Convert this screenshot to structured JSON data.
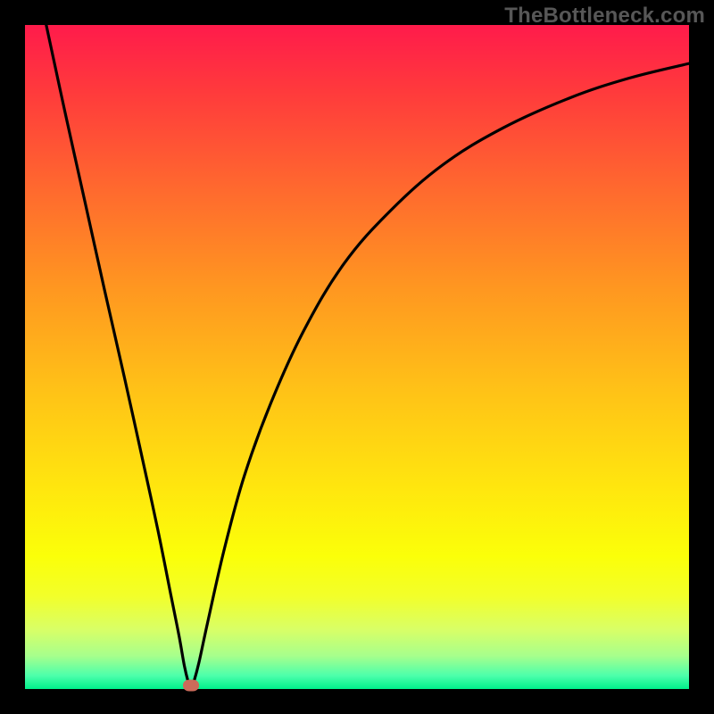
{
  "watermark": "TheBottleneck.com",
  "chart_data": {
    "type": "line",
    "title": "",
    "xlabel": "",
    "ylabel": "",
    "xlim": [
      0,
      1
    ],
    "ylim": [
      0,
      1
    ],
    "grid": false,
    "series": [
      {
        "name": "curve",
        "color": "#000000",
        "points": [
          {
            "x": 0.032,
            "y": 1.0
          },
          {
            "x": 0.06,
            "y": 0.87
          },
          {
            "x": 0.09,
            "y": 0.735
          },
          {
            "x": 0.12,
            "y": 0.6
          },
          {
            "x": 0.15,
            "y": 0.468
          },
          {
            "x": 0.175,
            "y": 0.355
          },
          {
            "x": 0.2,
            "y": 0.24
          },
          {
            "x": 0.22,
            "y": 0.14
          },
          {
            "x": 0.232,
            "y": 0.08
          },
          {
            "x": 0.24,
            "y": 0.035
          },
          {
            "x": 0.246,
            "y": 0.01
          },
          {
            "x": 0.25,
            "y": 0.0
          },
          {
            "x": 0.254,
            "y": 0.01
          },
          {
            "x": 0.262,
            "y": 0.04
          },
          {
            "x": 0.275,
            "y": 0.1
          },
          {
            "x": 0.3,
            "y": 0.21
          },
          {
            "x": 0.33,
            "y": 0.32
          },
          {
            "x": 0.37,
            "y": 0.43
          },
          {
            "x": 0.42,
            "y": 0.54
          },
          {
            "x": 0.48,
            "y": 0.64
          },
          {
            "x": 0.55,
            "y": 0.72
          },
          {
            "x": 0.63,
            "y": 0.79
          },
          {
            "x": 0.72,
            "y": 0.845
          },
          {
            "x": 0.82,
            "y": 0.89
          },
          {
            "x": 0.91,
            "y": 0.92
          },
          {
            "x": 1.0,
            "y": 0.942
          }
        ]
      }
    ],
    "marker": {
      "x": 0.25,
      "y": 0.006,
      "color": "#cc6b5a"
    },
    "background_gradient": [
      "#ff1b4b",
      "#ff3a3c",
      "#ff6a2e",
      "#ff9820",
      "#ffc217",
      "#ffe70e",
      "#fbff09",
      "#f2ff2a",
      "#d9ff66",
      "#a7ff8c",
      "#4cffab",
      "#00ef8a"
    ]
  }
}
